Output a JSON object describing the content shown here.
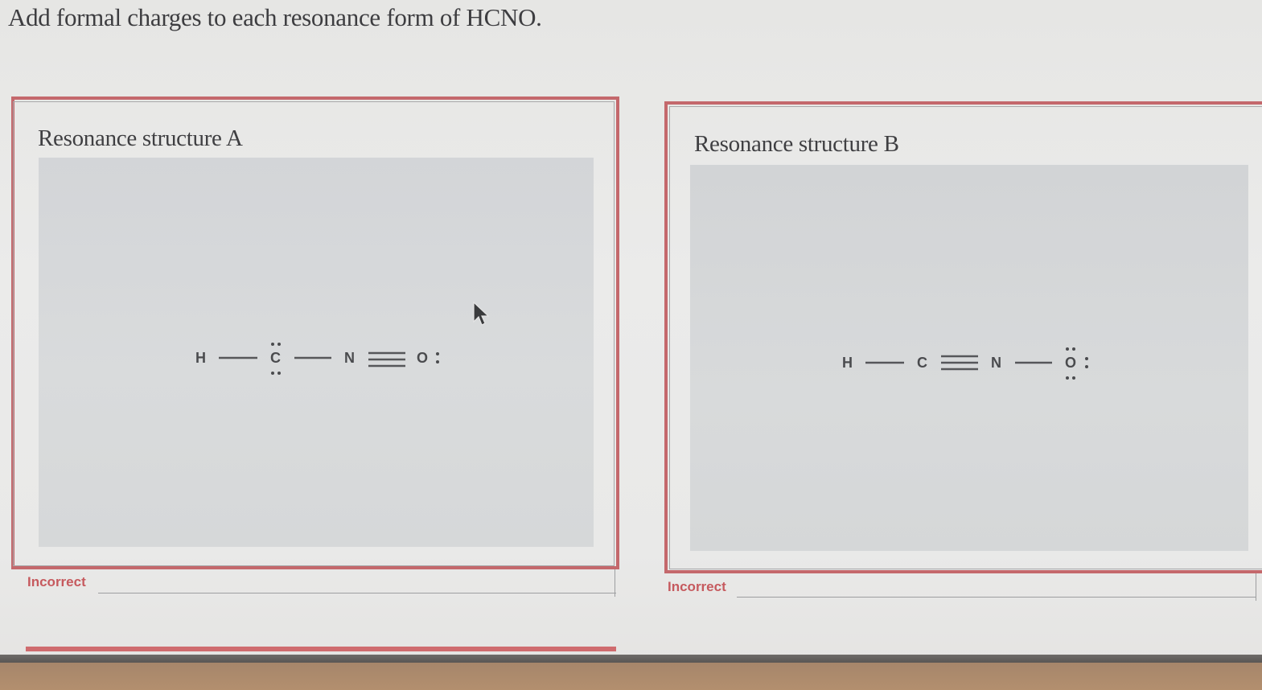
{
  "question": {
    "text": "Add formal charges to each resonance form of HCNO."
  },
  "structure_a": {
    "title": "Resonance structure A",
    "atoms": [
      "H",
      "C",
      "N",
      "O"
    ],
    "bonds": [
      "single",
      "single",
      "triple"
    ],
    "feedback": "Incorrect"
  },
  "structure_b": {
    "title": "Resonance structure B",
    "atoms": [
      "H",
      "C",
      "N",
      "O"
    ],
    "bonds": [
      "single",
      "triple",
      "single"
    ],
    "feedback": "Incorrect"
  },
  "colors": {
    "panel_border": "#c4686c",
    "feedback_incorrect": "#c65a5e",
    "canvas_bg": "#d7d9db"
  }
}
